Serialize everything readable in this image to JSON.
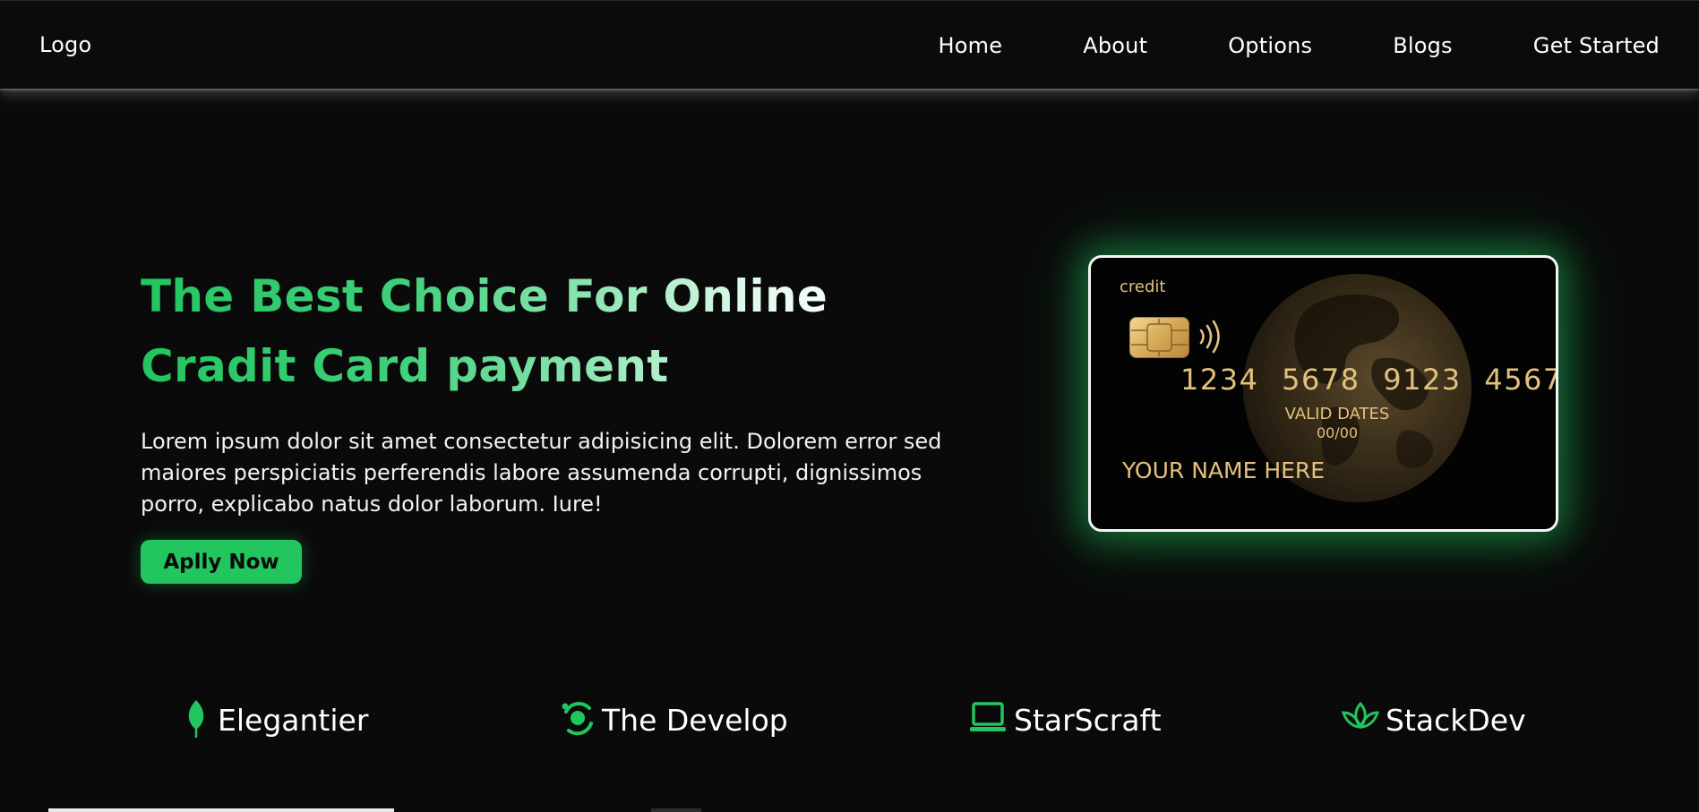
{
  "nav": {
    "logo": "Logo",
    "links": [
      {
        "label": "Home"
      },
      {
        "label": "About"
      },
      {
        "label": "Options"
      },
      {
        "label": "Blogs"
      },
      {
        "label": "Get Started"
      }
    ]
  },
  "hero": {
    "title_line1": "The Best Choice For Online",
    "title_line2": "Cradit Card payment",
    "description": "Lorem ipsum dolor sit amet consectetur adipisicing elit. Dolorem error sed maiores perspiciatis perferendis labore assumenda corrupti, dignissimos porro, explicabo natus dolor laborum. Iure!",
    "cta_label": "Aplly Now"
  },
  "card": {
    "brand": "credit",
    "number": "1234 5678 9123 4567",
    "valid_label": "VALID DATES",
    "valid_value": "00/00",
    "name": "YOUR NAME HERE"
  },
  "brands": [
    {
      "label": "Elegantier",
      "icon": "leaf-icon"
    },
    {
      "label": "The Develop",
      "icon": "orbit-icon"
    },
    {
      "label": "StarScraft",
      "icon": "laptop-icon"
    },
    {
      "label": "StackDev",
      "icon": "lotus-icon"
    }
  ],
  "colors": {
    "accent": "#22c55e",
    "background": "#0a0a0a",
    "card_gold": "#e3c07c"
  }
}
